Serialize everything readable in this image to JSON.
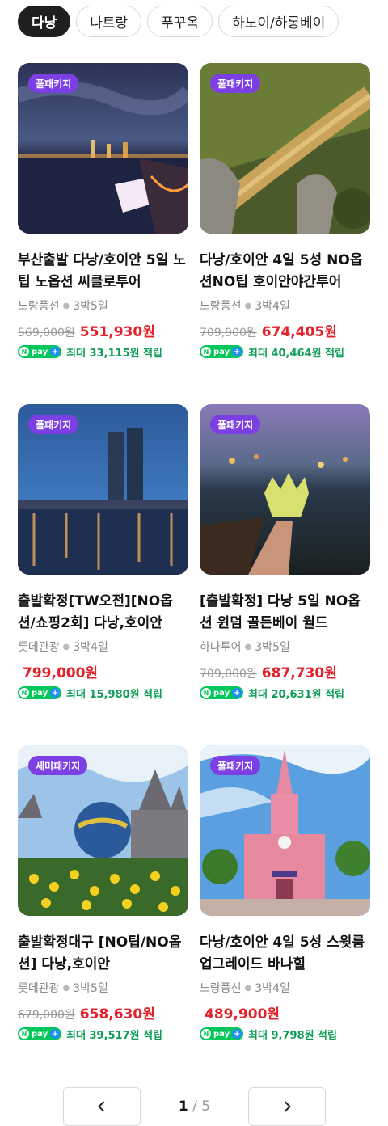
{
  "tabs": [
    {
      "label": "다낭",
      "active": true
    },
    {
      "label": "나트랑",
      "active": false
    },
    {
      "label": "푸꾸옥",
      "active": false
    },
    {
      "label": "하노이/하롱베이",
      "active": false
    }
  ],
  "products": [
    {
      "badge": "풀패키지",
      "title": "부산출발 다낭/호이안 5일 노팁 노옵션 씨클로투어",
      "agency": "노랑풍선",
      "duration": "3박5일",
      "original_price": "569,000원",
      "sale_price": "551,930원",
      "reward": "최대 33,115원 적립"
    },
    {
      "badge": "풀패키지",
      "title": "다낭/호이안 4일 5성 NO옵션NO팁 호이안야간투어",
      "agency": "노랑풍선",
      "duration": "3박4일",
      "original_price": "709,900원",
      "sale_price": "674,405원",
      "reward": "최대 40,464원 적립"
    },
    {
      "badge": "풀패키지",
      "title": "출발확정[TW오전][NO옵션/쇼핑2회] 다낭,호이안",
      "agency": "롯데관광",
      "duration": "3박4일",
      "original_price": "",
      "sale_price": "799,000원",
      "reward": "최대 15,980원 적립"
    },
    {
      "badge": "풀패키지",
      "title": "[출발확정] 다낭 5일 NO옵션 윈덤 골든베이 월드",
      "agency": "하나투어",
      "duration": "3박5일",
      "original_price": "709,000원",
      "sale_price": "687,730원",
      "reward": "최대 20,631원 적립"
    },
    {
      "badge": "세미패키지",
      "title": "출발확정대구 [NO팁/NO옵션] 다낭,호이안",
      "agency": "롯데관광",
      "duration": "3박5일",
      "original_price": "679,000원",
      "sale_price": "658,630원",
      "reward": "최대 39,517원 적립"
    },
    {
      "badge": "풀패키지",
      "title": "다낭/호이안 4일 5성 스윗룸업그레이드 바나힐",
      "agency": "노랑풍선",
      "duration": "3박4일",
      "original_price": "",
      "sale_price": "489,900원",
      "reward": "최대 9,798원 적립"
    }
  ],
  "npay_label": "pay",
  "pagination": {
    "current": "1",
    "separator": "/",
    "total": "5",
    "prev_icon": "chevron-left-icon",
    "next_icon": "chevron-right-icon"
  },
  "colors": {
    "badge": "#7b3fe4",
    "sale": "#e4202a",
    "reward": "#0f9d58",
    "npay": "#03c75a"
  }
}
